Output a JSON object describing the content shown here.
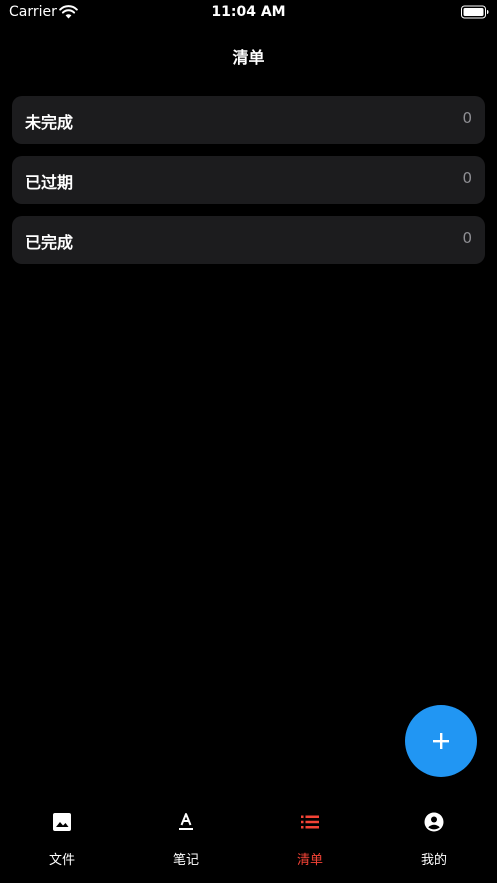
{
  "status_bar": {
    "carrier": "Carrier",
    "time": "11:04 AM"
  },
  "nav": {
    "title": "清单"
  },
  "list": [
    {
      "label": "未完成",
      "count": "0"
    },
    {
      "label": "已过期",
      "count": "0"
    },
    {
      "label": "已完成",
      "count": "0"
    }
  ],
  "fab": {
    "icon": "plus-icon"
  },
  "tabs": [
    {
      "label": "文件",
      "icon": "image-icon",
      "active": false
    },
    {
      "label": "笔记",
      "icon": "text-format-icon",
      "active": false
    },
    {
      "label": "清单",
      "icon": "list-icon",
      "active": true
    },
    {
      "label": "我的",
      "icon": "account-circle-icon",
      "active": false
    }
  ],
  "colors": {
    "background": "#000000",
    "row_background": "#1c1c1e",
    "accent_active": "#f44336",
    "fab": "#2196f3",
    "count_text": "#8e8e93"
  }
}
